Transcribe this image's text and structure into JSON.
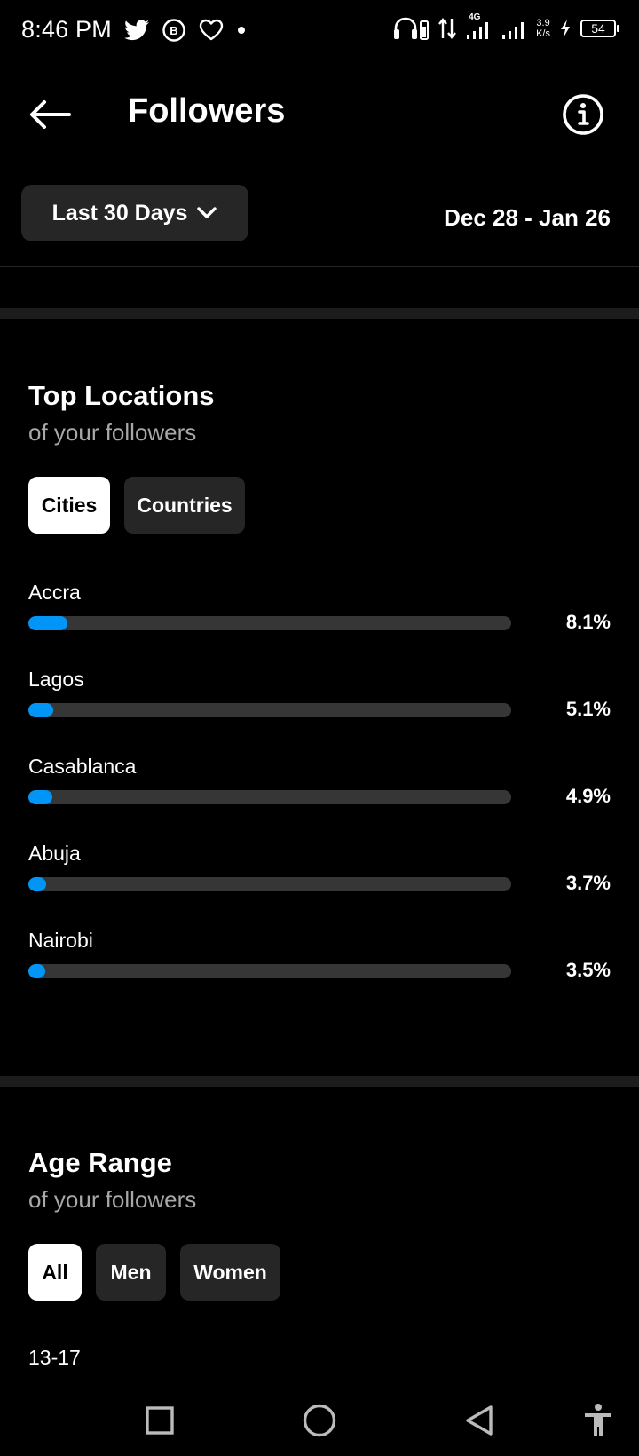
{
  "status_bar": {
    "time": "8:46 PM",
    "network": "4G",
    "net_speed_value": "3.9",
    "net_speed_unit": "K/s",
    "battery": "54",
    "left_icons": [
      "twitter-icon",
      "whatsapp-business-icon",
      "heart-icon",
      "dot-icon"
    ],
    "right_icons": [
      "headphones-icon",
      "data-arrows-icon",
      "signal-icon",
      "signal-icon",
      "charging-icon"
    ]
  },
  "header": {
    "title": "Followers",
    "back_icon": "arrow-left-icon",
    "info_icon": "info-icon"
  },
  "period": {
    "selected": "Last 30 Days",
    "date_range": "Dec 28 - Jan 26"
  },
  "top_locations": {
    "title": "Top Locations",
    "subtitle": "of your followers",
    "tabs": [
      {
        "label": "Cities",
        "active": true
      },
      {
        "label": "Countries",
        "active": false
      }
    ],
    "items": [
      {
        "name": "Accra",
        "percent_label": "8.1%",
        "value": 8.1
      },
      {
        "name": "Lagos",
        "percent_label": "5.1%",
        "value": 5.1
      },
      {
        "name": "Casablanca",
        "percent_label": "4.9%",
        "value": 4.9
      },
      {
        "name": "Abuja",
        "percent_label": "3.7%",
        "value": 3.7
      },
      {
        "name": "Nairobi",
        "percent_label": "3.5%",
        "value": 3.5
      }
    ]
  },
  "age_range": {
    "title": "Age Range",
    "subtitle": "of your followers",
    "tabs": [
      {
        "label": "All",
        "active": true
      },
      {
        "label": "Men",
        "active": false
      },
      {
        "label": "Women",
        "active": false
      }
    ],
    "first_label": "13-17"
  },
  "colors": {
    "accent": "#0095f6",
    "background": "#000000",
    "chip": "#262626",
    "track": "#363636"
  }
}
